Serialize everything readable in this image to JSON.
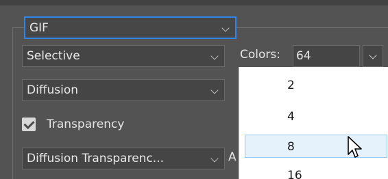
{
  "format_select": {
    "value": "GIF"
  },
  "reduction_select": {
    "value": "Selective"
  },
  "dither_select": {
    "value": "Diffusion"
  },
  "colors": {
    "label": "Colors:",
    "value": "64"
  },
  "transparency": {
    "label": "Transparency",
    "checked": true
  },
  "transparency_dither_select": {
    "value": "Diffusion Transparenc..."
  },
  "partial_label": "A",
  "colors_dropdown": {
    "options": [
      "2",
      "4",
      "8",
      "16"
    ],
    "highlighted": "8"
  },
  "accent_color": "#2f86e6",
  "icons": {
    "chevron": "chevron-down-icon",
    "check": "check-icon",
    "cursor": "mouse-pointer-icon"
  }
}
